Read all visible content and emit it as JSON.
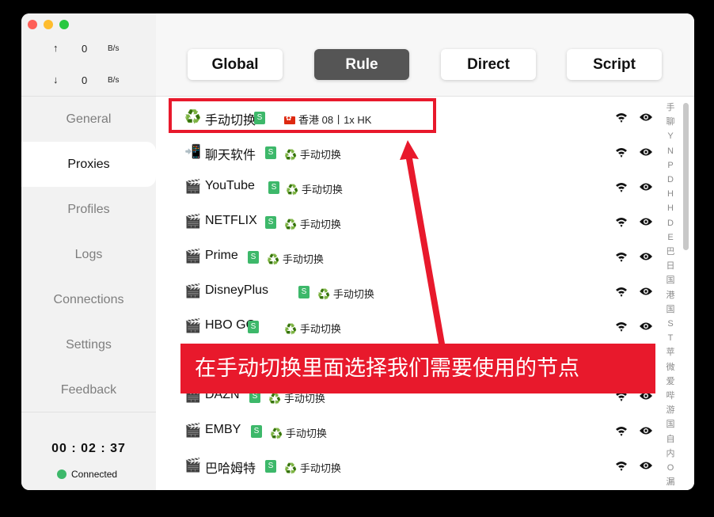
{
  "traffic": {
    "up_arrow": "↑",
    "up_value": "0",
    "up_unit": "B/s",
    "down_arrow": "↓",
    "down_value": "0",
    "down_unit": "B/s"
  },
  "nav": [
    "General",
    "Proxies",
    "Profiles",
    "Logs",
    "Connections",
    "Settings",
    "Feedback"
  ],
  "active_nav": "Proxies",
  "timer": "00 : 02 : 37",
  "status": "Connected",
  "modes": [
    "Global",
    "Rule",
    "Direct",
    "Script"
  ],
  "active_mode": "Rule",
  "groups": [
    {
      "icon": "♻️",
      "name": "手动切换",
      "badge": "S",
      "selected_flag": "hk",
      "selected": "香港 08丨1x HK"
    },
    {
      "icon": "📲",
      "name": "聊天软件",
      "badge": "S",
      "selected_icon": "♻️",
      "selected": "手动切换"
    },
    {
      "icon": "🎬",
      "name": "YouTube",
      "badge": "S",
      "selected_icon": "♻️",
      "selected": "手动切换"
    },
    {
      "icon": "🎬",
      "name": "NETFLIX",
      "badge": "S",
      "selected_icon": "♻️",
      "selected": "手动切换"
    },
    {
      "icon": "🎬",
      "name": "Prime",
      "badge": "S",
      "selected_icon": "♻️",
      "selected": "手动切换"
    },
    {
      "icon": "🎬",
      "name": "DisneyPlus",
      "badge": "S",
      "selected_icon": "♻️",
      "selected": "手动切换"
    },
    {
      "icon": "🎬",
      "name": "HBO GO",
      "badge": "S",
      "selected_icon": "♻️",
      "selected": "手动切换"
    },
    {
      "icon": "",
      "name": "",
      "badge": "",
      "selected": ""
    },
    {
      "icon": "🎬",
      "name": "DAZN",
      "badge": "S",
      "selected_icon": "♻️",
      "selected": "手动切换"
    },
    {
      "icon": "🎬",
      "name": "EMBY",
      "badge": "S",
      "selected_icon": "♻️",
      "selected": "手动切换"
    },
    {
      "icon": "🎬",
      "name": "巴哈姆特",
      "badge": "S",
      "selected_icon": "♻️",
      "selected": "手动切换"
    }
  ],
  "index_letters": [
    "手",
    "聊",
    "Y",
    "N",
    "P",
    "D",
    "H",
    "H",
    "D",
    "E",
    "巴",
    "日",
    "国",
    "港",
    "国",
    "S",
    "T",
    "苹",
    "微",
    "爱",
    "哔",
    "游",
    "国",
    "自",
    "内",
    "O",
    "漏"
  ],
  "annotation": {
    "banner_text": "在手动切换里面选择我们需要使用的节点",
    "color": "#e8192c"
  },
  "icons": {
    "row_action_1": "wifi-icon",
    "row_action_2": "eye-icon"
  }
}
